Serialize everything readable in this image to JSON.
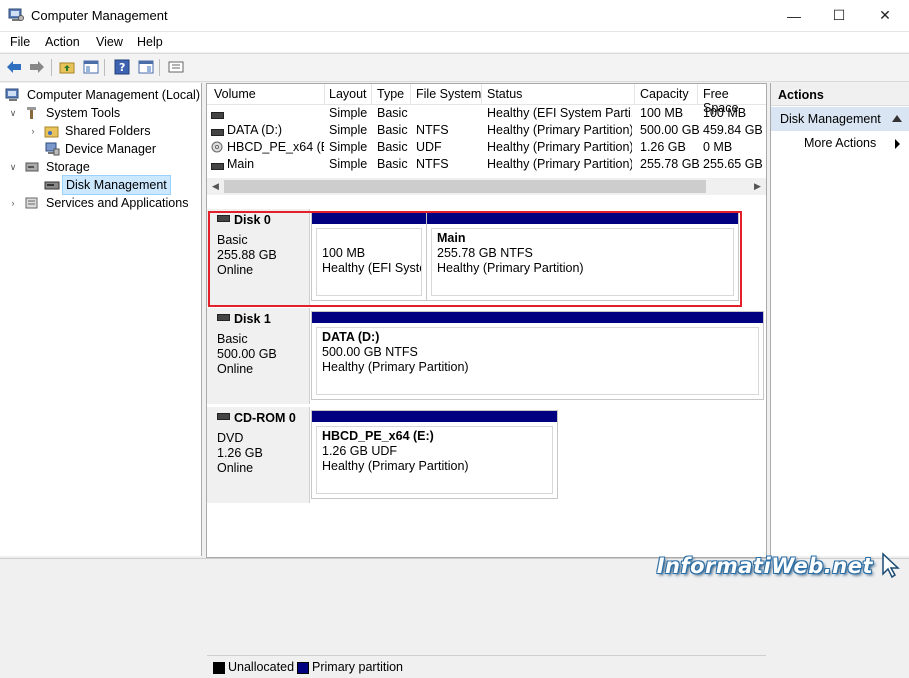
{
  "window": {
    "title": "Computer Management",
    "min_glyph": "—",
    "max_glyph": "☐",
    "close_glyph": "✕"
  },
  "menu": [
    "File",
    "Action",
    "View",
    "Help"
  ],
  "tree": {
    "root": "Computer Management (Local)",
    "system_tools": "System Tools",
    "shared_folders": "Shared Folders",
    "device_manager": "Device Manager",
    "storage": "Storage",
    "disk_management": "Disk Management",
    "services": "Services and Applications"
  },
  "volume_list": {
    "columns": [
      "Volume",
      "Layout",
      "Type",
      "File System",
      "Status",
      "Capacity",
      "Free Space"
    ],
    "rows": [
      {
        "volume": "",
        "layout": "Simple",
        "type": "Basic",
        "fs": "",
        "status": "Healthy (EFI System Parti...",
        "capacity": "100 MB",
        "free": "100 MB"
      },
      {
        "volume": "DATA (D:)",
        "layout": "Simple",
        "type": "Basic",
        "fs": "NTFS",
        "status": "Healthy (Primary Partition)",
        "capacity": "500.00 GB",
        "free": "459.84 GB"
      },
      {
        "volume": "HBCD_PE_x64 (E:)",
        "layout": "Simple",
        "type": "Basic",
        "fs": "UDF",
        "status": "Healthy (Primary Partition)",
        "capacity": "1.26 GB",
        "free": "0 MB"
      },
      {
        "volume": "Main",
        "layout": "Simple",
        "type": "Basic",
        "fs": "NTFS",
        "status": "Healthy (Primary Partition)",
        "capacity": "255.78 GB",
        "free": "255.65 GB"
      }
    ]
  },
  "disks": [
    {
      "name": "Disk 0",
      "kind": "Basic",
      "size": "255.88 GB",
      "state": "Online",
      "partitions": [
        {
          "title": "",
          "size": "100 MB",
          "status": "Healthy (EFI Systen"
        },
        {
          "title": "Main",
          "size": "255.78 GB NTFS",
          "status": "Healthy (Primary Partition)"
        }
      ]
    },
    {
      "name": "Disk 1",
      "kind": "Basic",
      "size": "500.00 GB",
      "state": "Online",
      "partitions": [
        {
          "title": "DATA  (D:)",
          "size": "500.00 GB NTFS",
          "status": "Healthy (Primary Partition)"
        }
      ]
    },
    {
      "name": "CD-ROM 0",
      "kind": "DVD",
      "size": "1.26 GB",
      "state": "Online",
      "partitions": [
        {
          "title": "HBCD_PE_x64  (E:)",
          "size": "1.26 GB UDF",
          "status": "Healthy (Primary Partition)"
        }
      ]
    }
  ],
  "legend": {
    "unallocated": "Unallocated",
    "primary": "Primary partition",
    "unallocated_color": "#000000",
    "primary_color": "#000080"
  },
  "actions": {
    "title": "Actions",
    "section": "Disk Management",
    "more": "More Actions"
  },
  "watermark": "InformatiWeb.net",
  "colors": {
    "highlight": "#e3202a",
    "partition_bar": "#000080",
    "selection": "#cce8ff"
  }
}
